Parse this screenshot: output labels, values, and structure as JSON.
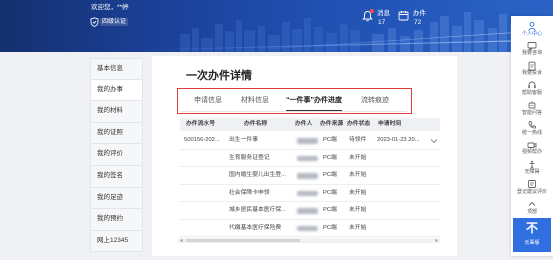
{
  "colors": {
    "header_bg": "#1c45a0",
    "accent": "#2f6fe0",
    "highlight_frame": "#e23b3b",
    "notification_dot": "#ff4d4f",
    "page_bg": "#eff1f5"
  },
  "header": {
    "welcome": "欢迎您，**婷",
    "cert_icon": "shield-icon",
    "cert_badge": "四级认证",
    "messages": {
      "icon": "bell-icon",
      "label": "消息",
      "count": "17"
    },
    "cases": {
      "icon": "calendar-icon",
      "label": "办件",
      "count": "72"
    }
  },
  "sidebar": {
    "active_index": 1,
    "items": [
      {
        "label": "基本信息"
      },
      {
        "label": "我的办事"
      },
      {
        "label": "我的材料"
      },
      {
        "label": "我的证照"
      },
      {
        "label": "我的评价"
      },
      {
        "label": "我的签名"
      },
      {
        "label": "我的足迹"
      },
      {
        "label": "我的预约"
      },
      {
        "label": "网上12345"
      }
    ]
  },
  "main": {
    "title": "一次办件详情",
    "active_tab_index": 2,
    "tabs": [
      {
        "label": "申请信息"
      },
      {
        "label": "材料信息"
      },
      {
        "label": "“一件事”办件进度"
      },
      {
        "label": "流转痕迹"
      }
    ],
    "table": {
      "columns": [
        "办件流水号",
        "办件名称",
        "办件人",
        "办件来源",
        "办件状态",
        "申请时间"
      ],
      "rows": [
        {
          "serial": "500156-202...",
          "name": "出生一件事",
          "source": "PC端",
          "status": "待领件",
          "time": "2023-01-23 20...",
          "expand_icon": "chevron-down-icon"
        },
        {
          "name": "生育服务证登记",
          "source": "PC端",
          "status": "未开始"
        },
        {
          "name": "国内婚生婴儿出生登...",
          "source": "PC端",
          "status": "未开始"
        },
        {
          "name": "社会保障卡申领",
          "source": "PC端",
          "status": "未开始"
        },
        {
          "name": "城乡居民基本医疗保...",
          "source": "PC端",
          "status": "未开始"
        },
        {
          "name": "代缴基本医疗保险费",
          "source": "PC端",
          "status": "未开始"
        }
      ]
    }
  },
  "float_toolbar": {
    "active_index": 0,
    "items": [
      {
        "label": "个人中心",
        "icon": "person-icon"
      },
      {
        "label": "我要咨询",
        "icon": "chat-icon"
      },
      {
        "label": "我要投诉",
        "icon": "clipboard-icon"
      },
      {
        "label": "帮助客服",
        "icon": "headset-icon"
      },
      {
        "label": "智能问答",
        "icon": "robot-icon"
      },
      {
        "label": "统一热线",
        "icon": "phone-icon"
      },
      {
        "label": "视频帮办",
        "icon": "video-icon"
      },
      {
        "label": "无障碍",
        "icon": "accessibility-icon"
      },
      {
        "label": "登记建议评价",
        "icon": "feedback-icon"
      },
      {
        "label": "顶部",
        "icon": "arrow-up-icon"
      }
    ],
    "elder_mode": {
      "glyph": "不",
      "label": "长辈版"
    }
  }
}
